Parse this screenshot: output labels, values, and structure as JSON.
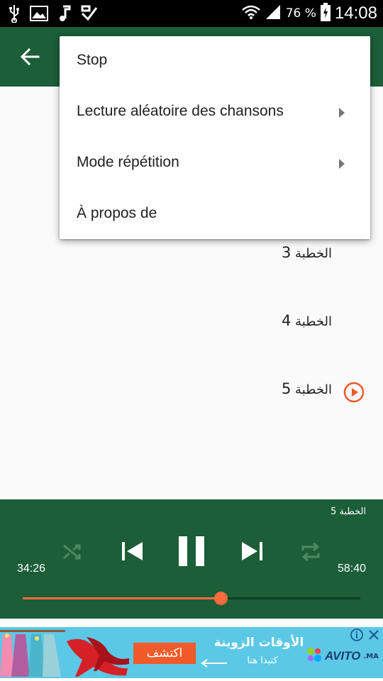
{
  "status_bar": {
    "battery_percent": "76 %",
    "time": "14:08",
    "left_icons": [
      "usb-icon",
      "image-icon",
      "music-note-icon",
      "check-icon"
    ],
    "right_icons": [
      "wifi-icon",
      "signal-icon",
      "battery-charging-icon"
    ]
  },
  "toolbar": {
    "back_icon": "arrow-back-icon",
    "color": "#1b5e37"
  },
  "list": {
    "items": [
      {
        "label": "الخطبة",
        "number": "3",
        "playing": false
      },
      {
        "label": "الخطبة",
        "number": "4",
        "playing": false
      },
      {
        "label": "الخطبة",
        "number": "5",
        "playing": true
      }
    ],
    "playing_icon": "play-circle-icon",
    "accent": "#f15a29"
  },
  "menu": {
    "items": [
      {
        "label": "Stop",
        "has_submenu": false
      },
      {
        "label": "Lecture aléatoire des chansons",
        "has_submenu": true
      },
      {
        "label": "Mode répétition",
        "has_submenu": true
      },
      {
        "label": "À propos de",
        "has_submenu": false
      }
    ]
  },
  "player": {
    "now_playing": "الخطبة 5",
    "elapsed": "34:26",
    "total": "58:40",
    "progress": 0.586,
    "controls": [
      "shuffle-icon",
      "skip-previous-icon",
      "pause-icon",
      "skip-next-icon",
      "repeat-icon"
    ],
    "accent": "#ff6a3d"
  },
  "ad": {
    "cta": "اكتشف",
    "headline": "الأوقات الزوينة",
    "subline": "كتبدا هنا",
    "brand": "AVITO",
    "brand_suffix": ".MA",
    "icons": [
      "ad-info-icon",
      "ad-close-icon",
      "dresses-icon",
      "red-shoes-icon",
      "arrow-left-icon",
      "avito-logo-icon"
    ]
  }
}
